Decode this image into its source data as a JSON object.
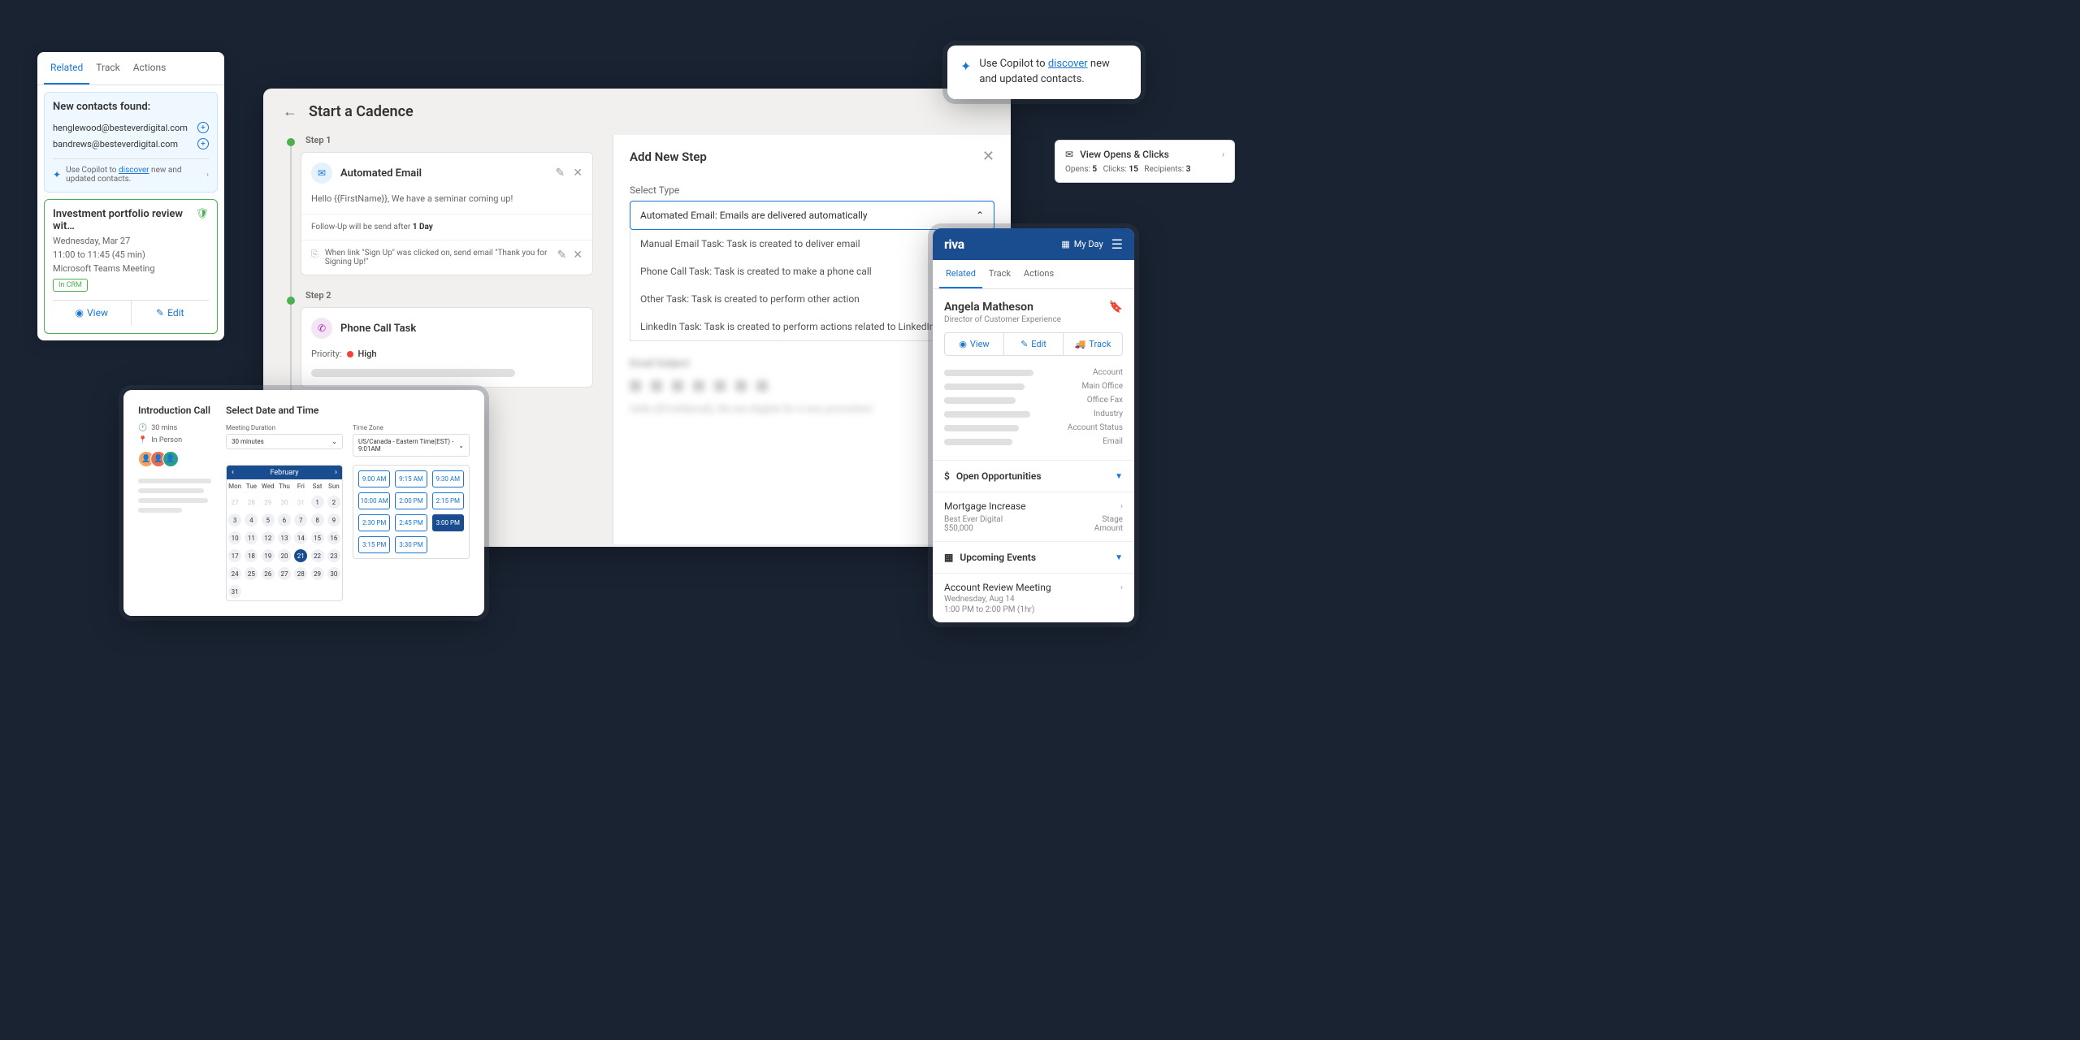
{
  "panel1": {
    "tabs": [
      "Related",
      "Track",
      "Actions"
    ],
    "contacts_title": "New contacts found:",
    "contacts": [
      "henglewood@besteverdigital.com",
      "bandrews@besteverdigital.com"
    ],
    "copilot_prefix": "Use Copilot to ",
    "copilot_link": "discover",
    "copilot_suffix": " new and updated contacts.",
    "meeting": {
      "title": "Investment portfolio review wit…",
      "date": "Wednesday, Mar 27",
      "time": "11:00 to 11:45 (45 min)",
      "location": "Microsoft Teams Meeting",
      "badge": "In CRM",
      "view": "View",
      "edit": "Edit"
    }
  },
  "panel2": {
    "title": "Start a Cadence",
    "step1_label": "Step 1",
    "step1_title": "Automated Email",
    "step1_body": "Hello {{FirstName}}, We have a seminar coming up!",
    "step1_followup_prefix": "Follow-Up will be send after ",
    "step1_followup_value": "1 Day",
    "step1_action": "When link \"Sign Up\" was clicked on, send email \"Thank you for Signing Up!\"",
    "step2_label": "Step 2",
    "step2_title": "Phone Call Task",
    "priority_label": "Priority:",
    "priority_value": "High",
    "right": {
      "title": "Add New Step",
      "select_label": "Select Type",
      "selected": "Automated Email: Emails are delivered automatically",
      "options": [
        "Manual Email Task: Task is created to deliver email",
        "Phone Call Task: Task is created to make a phone call",
        "Other Task: Task is created to perform other action",
        "LinkedIn Task: Task is created to perform actions related to LinkedIn"
      ],
      "blur_label": "Email Subject",
      "blur_text": "Hello {{FirstName}}, We are eligible for a new promotion!"
    }
  },
  "panel3": {
    "left_title": "Introduction Call",
    "duration_meta": "30 mins",
    "location_meta": "In Person",
    "right_title": "Select Date and Time",
    "duration_label": "Meeting Duration",
    "duration_value": "30 minutes",
    "tz_label": "Time Zone",
    "tz_value": "US/Canada - Eastern Time(EST) - 9:01AM",
    "month": "February",
    "dows": [
      "Mon",
      "Tue",
      "Wed",
      "Thu",
      "Fri",
      "Sat",
      "Sun"
    ],
    "days_prev": [
      27,
      28,
      29,
      30,
      31
    ],
    "days": [
      1,
      2,
      3,
      4,
      5,
      6,
      7,
      8,
      9,
      10,
      11,
      12,
      13,
      14,
      15,
      16,
      17,
      18,
      19,
      20,
      21,
      22,
      23,
      24,
      25,
      26,
      27,
      28,
      29,
      30,
      31
    ],
    "selected_day": 21,
    "timeslots": [
      "9:00 AM",
      "9:15 AM",
      "9:30 AM",
      "10:00 AM",
      "2:00 PM",
      "2:15 PM",
      "2:30 PM",
      "2:45 PM",
      "3:00 PM",
      "3:15 PM",
      "3:30 PM"
    ],
    "selected_slot": "3:00 PM"
  },
  "panel4": {
    "prefix": "Use Copilot to ",
    "link": "discover",
    "suffix": " new and updated contacts."
  },
  "panel5": {
    "title": "View Opens & Clicks",
    "opens_label": "Opens:",
    "opens": "5",
    "clicks_label": "Clicks:",
    "clicks": "15",
    "recipients_label": "Recipients:",
    "recipients": "3"
  },
  "panel6": {
    "logo": "riva",
    "myday": "My Day",
    "tabs": [
      "Related",
      "Track",
      "Actions"
    ],
    "contact_name": "Angela Matheson",
    "contact_role": "Director of Customer Experience",
    "view": "View",
    "edit": "Edit",
    "track": "Track",
    "fields": [
      "Account",
      "Main Office",
      "Office Fax",
      "Industry",
      "Account Status",
      "Email"
    ],
    "opportunities_title": "Open Opportunities",
    "opp_title": "Mortgage Increase",
    "opp_company": "Best Ever Digital",
    "opp_amount": "$50,000",
    "opp_stage_label": "Stage",
    "opp_amount_label": "Amount",
    "events_title": "Upcoming Events",
    "event_title": "Account Review Meeting",
    "event_date": "Wednesday, Aug 14",
    "event_time": "1:00 PM to 2:00 PM (1hr)"
  }
}
